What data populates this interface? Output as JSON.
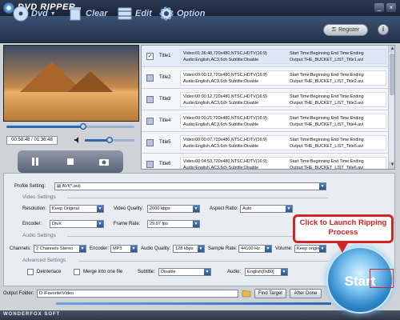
{
  "app": {
    "title": "DVD RIPPER",
    "brand_footer": "WONDERFOX SOFT"
  },
  "window": {
    "minimize": "_",
    "close": "×"
  },
  "toolbar": {
    "dvd_label": "Dvd",
    "clear_label": "Clear",
    "edit_label": "Edit",
    "option_label": "Option",
    "register_label": "Register",
    "info_label": "i"
  },
  "player": {
    "time": "00:58:48 / 01:36:48",
    "progress": 0.6,
    "volume": 0.5
  },
  "titles": [
    {
      "name": "Title1",
      "checked": true,
      "selected": true,
      "line1": "Video:01:36:48,720x480,NTSC,HDTV(16:9)",
      "line2": "Audio:English,AC3,6ch Subtitle:Disable",
      "start": "Start Time:Beginning End Time:Ending",
      "output": "Output:THE_BUCKET_LIST_Title1.avi"
    },
    {
      "name": "Title2",
      "checked": false,
      "selected": false,
      "line1": "Video:00:00:12,720x480,NTSC,HDTV(16:9)",
      "line2": "Audio:English,AC3,6ch Subtitle:Disable",
      "start": "Start Time:Beginning End Time:Ending",
      "output": "Output:THE_BUCKET_LIST_Title2.avi"
    },
    {
      "name": "Title3",
      "checked": false,
      "selected": false,
      "line1": "Video:00:00:12,720x480,NTSC,HDTV(16:9)",
      "line2": "Audio:English,AC3,6ch Subtitle:Disable",
      "start": "Start Time:Beginning End Time:Ending",
      "output": "Output:THE_BUCKET_LIST_Title3.avi"
    },
    {
      "name": "Title4",
      "checked": false,
      "selected": false,
      "line1": "Video:00:00:21,720x480,NTSC,HDTV(16:9)",
      "line2": "Audio:English,AC3,6ch Subtitle:Disable",
      "start": "Start Time:Beginning End Time:Ending",
      "output": "Output:THE_BUCKET_LIST_Title4.avi"
    },
    {
      "name": "Title5",
      "checked": false,
      "selected": false,
      "line1": "Video:00:00:07,720x480,NTSC,HDTV(16:9)",
      "line2": "Audio:English,AC3,6ch Subtitle:Disable",
      "start": "Start Time:Beginning End Time:Ending",
      "output": "Output:THE_BUCKET_LIST_Title5.avi"
    },
    {
      "name": "Title6",
      "checked": false,
      "selected": false,
      "line1": "Video:00:04:53,720x480,NTSC,HDTV(16:9)",
      "line2": "Audio:English,AC3,6ch Subtitle:Disable",
      "start": "Start Time:Beginning End Time:Ending",
      "output": "Output:THE_BUCKET_LIST_Title6.avi"
    }
  ],
  "settings": {
    "profile_label": "Profile Setting:",
    "profile_value": "AVI(*.avi)",
    "video_section": "Video Settings",
    "audio_section": "Audio Settings",
    "advanced_section": "Advanced Settings",
    "resolution_label": "Resolution:",
    "resolution_value": "Keep Original",
    "video_quality_label": "Video Quality:",
    "video_quality_value": "2000 kbps",
    "aspect_label": "Aspect Ratio:",
    "aspect_value": "Auto",
    "encoder_label": "Encoder:",
    "encoder_value": "DivX",
    "frame_rate_label": "Frame Rate:",
    "frame_rate_value": "29.97 fps",
    "channels_label": "Channels:",
    "channels_value": "2 Channels Stereo",
    "audio_encoder_label": "Encoder:",
    "audio_encoder_value": "MP3",
    "audio_quality_label": "Audio Quality:",
    "audio_quality_value": "128 kbps",
    "sample_rate_label": "Sample Rate:",
    "sample_rate_value": "44100 Hz",
    "volume_label": "Volume:",
    "volume_value": "Keep origina",
    "deinterlace_label": "Deinterlace",
    "merge_label": "Merge into one file",
    "subtitle_label": "Subtitle:",
    "subtitle_value": "Disable",
    "audio_label": "Audio:",
    "audio_value": "English[0x80]"
  },
  "output": {
    "folder_label": "Output Folder:",
    "folder_value": "D:\\Favorite\\Video",
    "find_target": "Find Target",
    "after_done": "After Done"
  },
  "start": {
    "label": "Start",
    "callout": "Click to Launch Ripping Process"
  }
}
